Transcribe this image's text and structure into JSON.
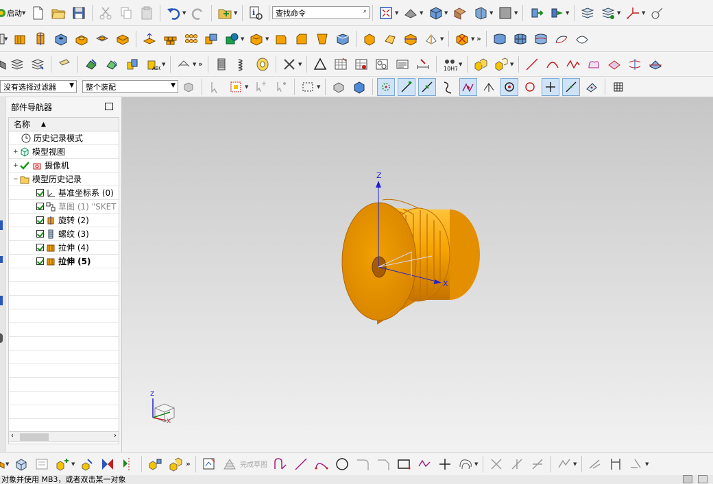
{
  "toolbar": {
    "start_label": "启动",
    "search_command_placeholder": "查找命令",
    "filter_label": "没有选择过滤器",
    "assembly_label": "整个装配"
  },
  "sketch_bar": {
    "finish_sketch_label": "完成草图"
  },
  "navigator": {
    "title": "部件导航器",
    "column_header": "名称",
    "items": [
      {
        "label": "历史记录模式"
      },
      {
        "label": "模型视图"
      },
      {
        "label": "摄像机"
      },
      {
        "label": "模型历史记录"
      },
      {
        "label": "基准坐标系 (0)"
      },
      {
        "label": "草图 (1) \"SKET"
      },
      {
        "label": "旋转 (2)"
      },
      {
        "label": "螺纹 (3)"
      },
      {
        "label": "拉伸 (4)"
      },
      {
        "label": "拉伸 (5)"
      }
    ]
  },
  "viewport": {
    "axis_z": "Z",
    "axis_x": "X",
    "triad_z": "Z",
    "triad_x": "X"
  },
  "status": {
    "text": "对象并使用 MB3，或者双击某一对象"
  },
  "colors": {
    "part_orange": "#f5a300",
    "part_dark": "#c87400",
    "datum_blue": "#2020d0",
    "viewport_top": "#c6c6c6",
    "viewport_bottom": "#f2f2f2"
  }
}
